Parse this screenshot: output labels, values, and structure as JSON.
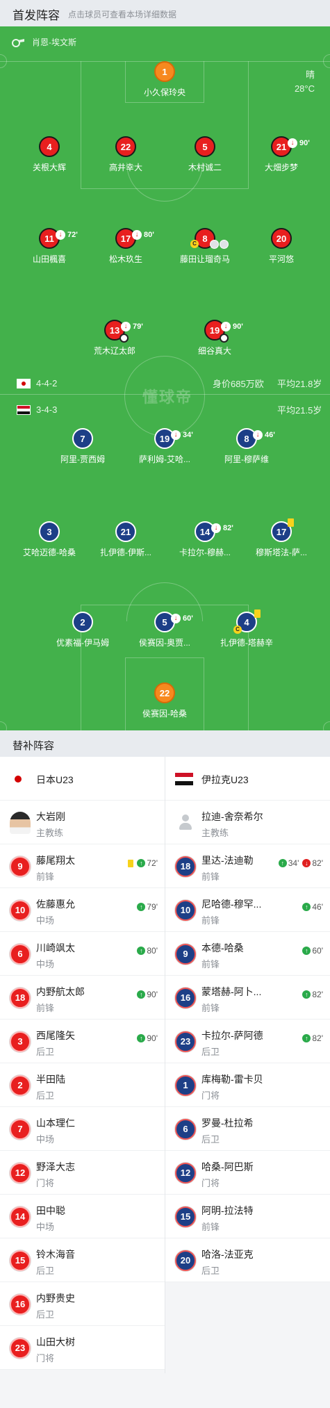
{
  "header": {
    "title": "首发阵容",
    "hint": "点击球员可查看本场详细数据"
  },
  "pitch": {
    "referee": "肖恩-埃文斯",
    "weather": {
      "condition": "晴",
      "temperature": "28°C"
    },
    "watermark": "懂球帝",
    "home": {
      "formation": "4-4-2",
      "value": "身价685万欧",
      "avg_age": "平均21.8岁"
    },
    "away": {
      "formation": "3-4-3",
      "avg_age": "平均21.5岁"
    },
    "home_players": [
      {
        "number": "1",
        "name": "小久保玲央",
        "color": "orange"
      },
      {
        "number": "4",
        "name": "关根大辉",
        "color": "red"
      },
      {
        "number": "22",
        "name": "高井幸大",
        "color": "red"
      },
      {
        "number": "5",
        "name": "木村诚二",
        "color": "red"
      },
      {
        "number": "21",
        "name": "大畑步梦",
        "color": "red",
        "sub": "90'"
      },
      {
        "number": "11",
        "name": "山田楓喜",
        "color": "red",
        "sub": "72'"
      },
      {
        "number": "17",
        "name": "松木玖生",
        "color": "red",
        "sub": "80'"
      },
      {
        "number": "8",
        "name": "藤田让瑠奇马",
        "color": "red"
      },
      {
        "number": "20",
        "name": "平河悠",
        "color": "red"
      },
      {
        "number": "13",
        "name": "荒木辽太郎",
        "color": "red",
        "sub": "79'"
      },
      {
        "number": "19",
        "name": "细谷真大",
        "color": "red",
        "sub": "90'"
      }
    ],
    "away_players": [
      {
        "number": "7",
        "name": "阿里-贾西姆",
        "color": "navy"
      },
      {
        "number": "19",
        "name": "萨利姆-艾哈...",
        "color": "navy",
        "sub": "34'"
      },
      {
        "number": "8",
        "name": "阿里-穆萨维",
        "color": "navy",
        "sub": "46'"
      },
      {
        "number": "3",
        "name": "艾哈迈德-哈桑",
        "color": "navy"
      },
      {
        "number": "21",
        "name": "扎伊德-伊斯...",
        "color": "navy"
      },
      {
        "number": "14",
        "name": "卡拉尔-穆赫...",
        "color": "navy",
        "sub": "82'"
      },
      {
        "number": "17",
        "name": "穆斯塔法-萨...",
        "color": "navy"
      },
      {
        "number": "2",
        "name": "优素福-伊马姆",
        "color": "navy"
      },
      {
        "number": "5",
        "name": "侯赛因-奥贾...",
        "color": "navy",
        "sub": "60'"
      },
      {
        "number": "4",
        "name": "扎伊德-塔赫辛",
        "color": "navy"
      },
      {
        "number": "22",
        "name": "侯赛因-哈桑",
        "color": "orange"
      }
    ]
  },
  "subs": {
    "title": "替补阵容",
    "home_team": "日本U23",
    "away_team": "伊拉克U23",
    "home_coach": {
      "name": "大岩刚",
      "role": "主教练"
    },
    "away_coach": {
      "name": "拉迪-舍奈希尔",
      "role": "主教练"
    },
    "home": [
      {
        "number": "9",
        "name": "藤尾翔太",
        "pos": "前锋",
        "events": [
          {
            "type": "yc"
          },
          {
            "type": "up",
            "min": "72'"
          }
        ]
      },
      {
        "number": "10",
        "name": "佐藤惠允",
        "pos": "中场",
        "events": [
          {
            "type": "up",
            "min": "79'"
          }
        ]
      },
      {
        "number": "6",
        "name": "川崎飒太",
        "pos": "中场",
        "events": [
          {
            "type": "up",
            "min": "80'"
          }
        ]
      },
      {
        "number": "18",
        "name": "内野航太郎",
        "pos": "前锋",
        "events": [
          {
            "type": "up",
            "min": "90'"
          }
        ]
      },
      {
        "number": "3",
        "name": "西尾隆矢",
        "pos": "后卫",
        "events": [
          {
            "type": "up",
            "min": "90'"
          }
        ]
      },
      {
        "number": "2",
        "name": "半田陆",
        "pos": "后卫",
        "events": []
      },
      {
        "number": "7",
        "name": "山本理仁",
        "pos": "中场",
        "events": []
      },
      {
        "number": "12",
        "name": "野泽大志",
        "pos": "门将",
        "events": []
      },
      {
        "number": "14",
        "name": "田中聪",
        "pos": "中场",
        "events": []
      },
      {
        "number": "15",
        "name": "铃木海音",
        "pos": "后卫",
        "events": []
      },
      {
        "number": "16",
        "name": "内野贵史",
        "pos": "后卫",
        "events": []
      },
      {
        "number": "23",
        "name": "山田大树",
        "pos": "门将",
        "events": []
      }
    ],
    "away": [
      {
        "number": "18",
        "name": "里达-法迪勒",
        "pos": "前锋",
        "events": [
          {
            "type": "up",
            "min": "34'"
          },
          {
            "type": "dn",
            "min": "82'"
          }
        ]
      },
      {
        "number": "10",
        "name": "尼哈德-穆罕...",
        "pos": "前锋",
        "events": [
          {
            "type": "up",
            "min": "46'"
          }
        ]
      },
      {
        "number": "9",
        "name": "本德-哈桑",
        "pos": "前锋",
        "events": [
          {
            "type": "up",
            "min": "60'"
          }
        ]
      },
      {
        "number": "16",
        "name": "蒙塔赫-阿卜...",
        "pos": "前锋",
        "events": [
          {
            "type": "up",
            "min": "82'"
          }
        ]
      },
      {
        "number": "23",
        "name": "卡拉尔-萨阿德",
        "pos": "后卫",
        "events": [
          {
            "type": "up",
            "min": "82'"
          }
        ]
      },
      {
        "number": "1",
        "name": "库梅勒-雷卡贝",
        "pos": "门将",
        "events": []
      },
      {
        "number": "6",
        "name": "罗曼-杜拉希",
        "pos": "后卫",
        "events": []
      },
      {
        "number": "12",
        "name": "哈桑-阿巴斯",
        "pos": "门将",
        "events": []
      },
      {
        "number": "15",
        "name": "阿明-拉法特",
        "pos": "前锋",
        "events": []
      },
      {
        "number": "20",
        "name": "哈洛-法亚克",
        "pos": "后卫",
        "events": []
      }
    ]
  }
}
